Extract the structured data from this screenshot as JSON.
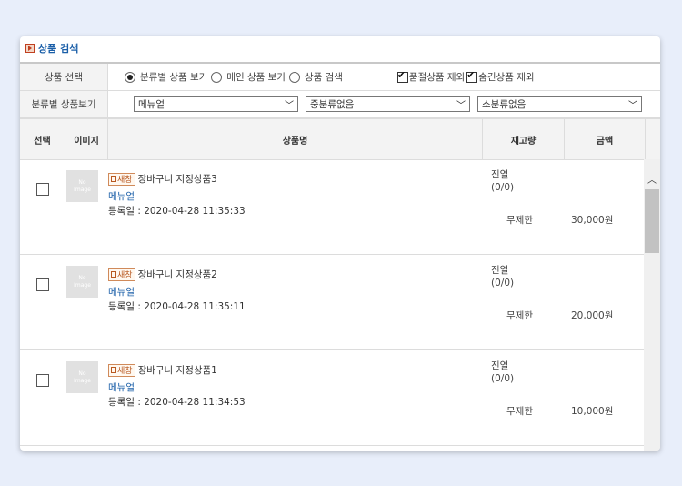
{
  "title": "상품 검색",
  "filter": {
    "row1_label": "상품 선택",
    "radio_category": "분류별 상품 보기",
    "radio_main": "메인 상품 보기",
    "radio_search": "상품 검색",
    "check_soldout": "품절상품 제외",
    "check_hidden": "숨긴상품 제외",
    "row2_label": "분류별 상품보기",
    "select1": "메뉴얼",
    "select2": "중분류없음",
    "select3": "소분류없음"
  },
  "table": {
    "headers": [
      "선택",
      "이미지",
      "상품명",
      "재고량",
      "금액"
    ],
    "rows": [
      {
        "thumb_line1": "No",
        "thumb_line2": "Image",
        "badge": "새창",
        "name": "장바구니 지정상품3",
        "category": "메뉴얼",
        "date": "등록일 : 2020-04-28 11:35:33",
        "stock_status": "진열",
        "stock_count": "(0/0)",
        "stock_limit": "무제한",
        "price": "30,000원"
      },
      {
        "thumb_line1": "No",
        "thumb_line2": "Image",
        "badge": "새창",
        "name": "장바구니 지정상품2",
        "category": "메뉴얼",
        "date": "등록일 : 2020-04-28 11:35:11",
        "stock_status": "진열",
        "stock_count": "(0/0)",
        "stock_limit": "무제한",
        "price": "20,000원"
      },
      {
        "thumb_line1": "No",
        "thumb_line2": "Image",
        "badge": "새창",
        "name": "장바구니 지정상품1",
        "category": "메뉴얼",
        "date": "등록일 : 2020-04-28 11:34:53",
        "stock_status": "진열",
        "stock_count": "(0/0)",
        "stock_limit": "무제한",
        "price": "10,000원"
      }
    ]
  },
  "colors": {
    "accent": "#1b5fa8",
    "background": "#e8eefa",
    "badge": "#b85820"
  }
}
